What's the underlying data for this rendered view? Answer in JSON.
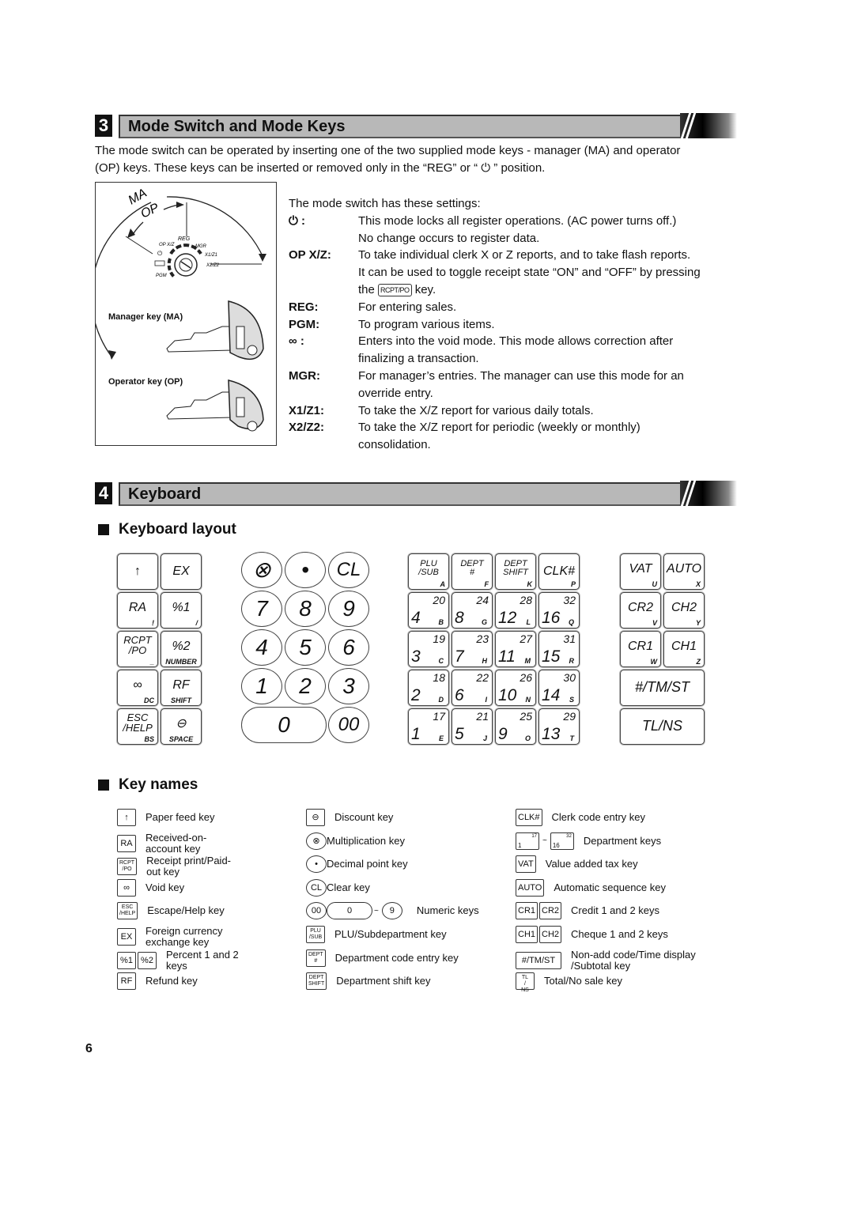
{
  "sections": [
    {
      "number": "3",
      "title": "Mode Switch and Mode Keys"
    },
    {
      "number": "4",
      "title": "Keyboard"
    }
  ],
  "intro": {
    "line1": "The mode switch can be operated by inserting one of the two supplied mode keys - manager (MA) and operator",
    "line2_pre": "(OP) keys.  These keys can be inserted or removed only in the “REG” or “",
    "line2_icon": "power-icon",
    "line2_post": "” position."
  },
  "mode_diagram": {
    "arc_labels": {
      "ma": "MA",
      "op": "OP"
    },
    "positions": [
      "OP X/Z",
      "REG",
      "MGR",
      "X1/Z1",
      "X2/Z2",
      "PGM"
    ],
    "manager_key_label": "Manager key (MA)",
    "operator_key_label": "Operator key (OP)",
    "manager_key_tag": "MA",
    "operator_key_tag": "OP"
  },
  "settings": {
    "heading": "The mode switch has these settings:",
    "rows": [
      {
        "term": "⏻ :",
        "lines": [
          "This mode locks all register operations. (AC power turns off.)",
          "No change occurs to register data."
        ]
      },
      {
        "term": "OP X/Z:",
        "lines": [
          "To take individual clerk X or Z reports, and to take flash reports.",
          "It can be used to toggle receipt state “ON” and “OFF” by pressing"
        ]
      },
      {
        "term": "REG:",
        "lines": [
          "For entering sales."
        ]
      },
      {
        "term": "PGM:",
        "lines": [
          "To program various items."
        ]
      },
      {
        "term": "∞ :",
        "lines": [
          "Enters into the void mode.  This mode allows correction after",
          "finalizing a transaction."
        ]
      },
      {
        "term": "MGR:",
        "lines": [
          "For manager’s entries.  The manager can use this mode for an",
          "override entry."
        ]
      },
      {
        "term": "X1/Z1:",
        "lines": [
          "To take the X/Z report for various daily totals."
        ]
      },
      {
        "term": "X2/Z2:",
        "lines": [
          "To take the X/Z report for periodic (weekly or monthly)",
          "consolidation."
        ]
      }
    ],
    "rcpt_line": {
      "pre": "the",
      "key": "RCPT/PO",
      "post": "key."
    }
  },
  "keyboard_layout": {
    "heading": "Keyboard layout",
    "left_keys": [
      {
        "main": "↑",
        "sub": ""
      },
      {
        "main": "EX",
        "sub": ""
      },
      {
        "main": "RA",
        "sub": "!"
      },
      {
        "main": "%1",
        "sub": "/"
      },
      {
        "main": "RCPT /PO",
        "sub": "_"
      },
      {
        "main": "%2",
        "sub": "NUMBER"
      },
      {
        "main": "∞",
        "sub": "DC"
      },
      {
        "main": "RF",
        "sub": "SHIFT"
      },
      {
        "main": "ESC /HELP",
        "sub": "BS"
      },
      {
        "main": "⊖",
        "sub": "SPACE"
      }
    ],
    "numeric_keys": [
      "⊗",
      "•",
      "CL",
      "7",
      "8",
      "9",
      "4",
      "5",
      "6",
      "1",
      "2",
      "3",
      "0",
      "00"
    ],
    "top_func_keys": [
      {
        "main": "PLU /SUB",
        "sub": "A"
      },
      {
        "main": "DEPT #",
        "sub": "F"
      },
      {
        "main": "DEPT SHIFT",
        "sub": "K"
      },
      {
        "main": "CLK#",
        "sub": "P"
      }
    ],
    "dept_keys": [
      {
        "num": "4",
        "top": "20",
        "ltr": "B"
      },
      {
        "num": "8",
        "top": "24",
        "ltr": "G"
      },
      {
        "num": "12",
        "top": "28",
        "ltr": "L"
      },
      {
        "num": "16",
        "top": "32",
        "ltr": "Q"
      },
      {
        "num": "3",
        "top": "19",
        "ltr": "C"
      },
      {
        "num": "7",
        "top": "23",
        "ltr": "H"
      },
      {
        "num": "11",
        "top": "27",
        "ltr": "M"
      },
      {
        "num": "15",
        "top": "31",
        "ltr": "R"
      },
      {
        "num": "2",
        "top": "18",
        "ltr": "D"
      },
      {
        "num": "6",
        "top": "22",
        "ltr": "I"
      },
      {
        "num": "10",
        "top": "26",
        "ltr": "N"
      },
      {
        "num": "14",
        "top": "30",
        "ltr": "S"
      },
      {
        "num": "1",
        "top": "17",
        "ltr": "E"
      },
      {
        "num": "5",
        "top": "21",
        "ltr": "J"
      },
      {
        "num": "9",
        "top": "25",
        "ltr": "O"
      },
      {
        "num": "13",
        "top": "29",
        "ltr": "T"
      }
    ],
    "right_keys": [
      {
        "main": "VAT",
        "sub": "U"
      },
      {
        "main": "AUTO",
        "sub": "X"
      },
      {
        "main": "CR2",
        "sub": "V"
      },
      {
        "main": "CH2",
        "sub": "Y"
      },
      {
        "main": "CR1",
        "sub": "W"
      },
      {
        "main": "CH1",
        "sub": "Z"
      },
      {
        "main": "#/TM/ST",
        "sub": ""
      },
      {
        "main": "TL/NS",
        "sub": ""
      }
    ]
  },
  "key_names": {
    "heading": "Key names",
    "col1": [
      {
        "keys": [
          "↑"
        ],
        "desc": "Paper feed key"
      },
      {
        "keys": [
          "RA"
        ],
        "desc": "Received-on-account key"
      },
      {
        "keys": [
          "RCPT /PO"
        ],
        "desc": "Receipt print/Paid-out key"
      },
      {
        "keys": [
          "∞"
        ],
        "desc": "Void key"
      },
      {
        "keys": [
          "ESC /HELP"
        ],
        "desc": "Escape/Help key"
      },
      {
        "keys": [
          "EX"
        ],
        "desc": "Foreign currency exchange key"
      },
      {
        "keys": [
          "%1",
          "%2"
        ],
        "desc": "Percent 1 and 2 keys"
      },
      {
        "keys": [
          "RF"
        ],
        "desc": "Refund key"
      }
    ],
    "col2": [
      {
        "keys": [
          "⊖"
        ],
        "desc": "Discount key"
      },
      {
        "keys": [
          "⊗"
        ],
        "desc": "Multiplication key"
      },
      {
        "keys": [
          "•"
        ],
        "desc": "Decimal point key"
      },
      {
        "keys": [
          "CL"
        ],
        "desc": "Clear key"
      },
      {
        "keys": [
          "00",
          "0",
          "~",
          "9"
        ],
        "desc": "Numeric keys"
      },
      {
        "keys": [
          "PLU /SUB"
        ],
        "desc": "PLU/Subdepartment key"
      },
      {
        "keys": [
          "DEPT #"
        ],
        "desc": "Department code entry key"
      },
      {
        "keys": [
          "DEPT SHIFT"
        ],
        "desc": "Department shift key"
      }
    ],
    "col3": [
      {
        "keys": [
          "CLK#"
        ],
        "desc": "Clerk code entry key"
      },
      {
        "keys": [
          "1|17",
          "~",
          "16|32"
        ],
        "desc": "Department keys"
      },
      {
        "keys": [
          "VAT"
        ],
        "desc": "Value added tax key"
      },
      {
        "keys": [
          "AUTO"
        ],
        "desc": "Automatic sequence key"
      },
      {
        "keys": [
          "CR1",
          "CR2"
        ],
        "desc": "Credit 1 and 2 keys"
      },
      {
        "keys": [
          "CH1",
          "CH2"
        ],
        "desc": "Cheque 1 and 2 keys"
      },
      {
        "keys": [
          "#/TM/ST"
        ],
        "desc": "Non-add code/Time display /Subtotal key"
      },
      {
        "keys": [
          "TL / NS"
        ],
        "desc": "Total/No sale key"
      }
    ]
  },
  "page_number": "6"
}
